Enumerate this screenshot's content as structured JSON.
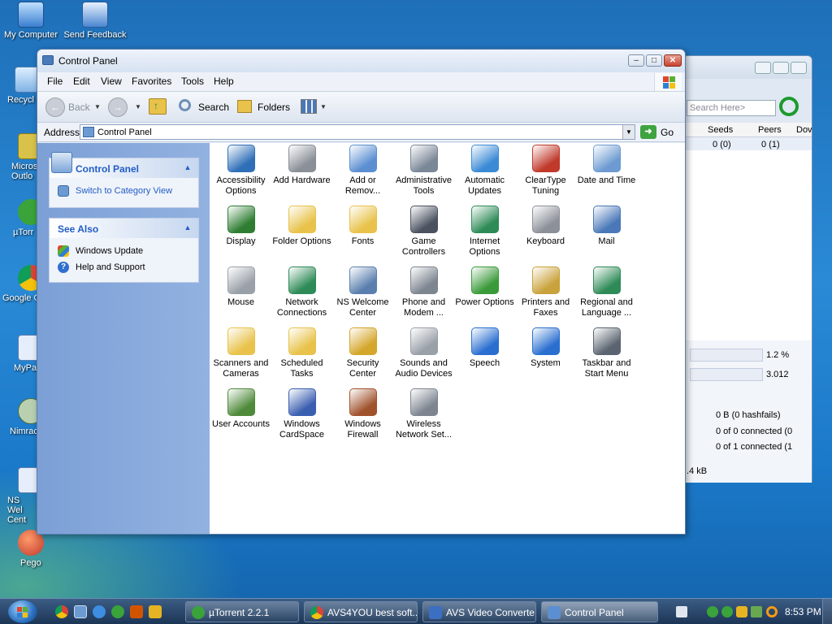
{
  "desktop": {
    "icons": [
      {
        "label": "My Computer"
      },
      {
        "label": "Send Feedback"
      },
      {
        "label": "Recycl"
      },
      {
        "label": "Micros Outlo"
      },
      {
        "label": "µTorr"
      },
      {
        "label": "Google C"
      },
      {
        "label": "MyPa"
      },
      {
        "label": "Nimrac"
      },
      {
        "label": "NS Wel Cent"
      },
      {
        "label": "Pego"
      }
    ]
  },
  "background_window": {
    "search_placeholder": "Search Here>",
    "columns": {
      "seeds": "Seeds",
      "peers": "Peers",
      "down": "Dov"
    },
    "row": {
      "seeds": "0 (0)",
      "peers": "0 (1)"
    },
    "stats": {
      "pct": "1.2 %",
      "ratio": "3.012"
    },
    "info": [
      "0 B (0 hashfails)",
      "0 of 0 connected (0",
      "0 of 1 connected (1"
    ],
    "status": ".4 kB"
  },
  "window": {
    "title": "Control Panel",
    "menu": [
      "File",
      "Edit",
      "View",
      "Favorites",
      "Tools",
      "Help"
    ],
    "toolbar": {
      "back": "Back",
      "search": "Search",
      "folders": "Folders"
    },
    "address": {
      "label": "Address",
      "value": "Control Panel",
      "go": "Go"
    }
  },
  "leftpane": {
    "control_panel": {
      "title": "Control Panel",
      "link": "Switch to Category View"
    },
    "see_also": {
      "title": "See Also",
      "links": [
        "Windows Update",
        "Help and Support"
      ]
    }
  },
  "items": [
    {
      "line1": "Accessibility",
      "line2": "Options",
      "icon": "accessibility-icon",
      "color": "#2f6fb8"
    },
    {
      "line1": "Add Hardware",
      "line2": "",
      "icon": "add-hardware-icon",
      "color": "#8a8f98"
    },
    {
      "line1": "Add or",
      "line2": "Remov...",
      "icon": "add-remove-programs-icon",
      "color": "#5b8fd1"
    },
    {
      "line1": "Administrative",
      "line2": "Tools",
      "icon": "administrative-tools-icon",
      "color": "#7a8797"
    },
    {
      "line1": "Automatic",
      "line2": "Updates",
      "icon": "automatic-updates-icon",
      "color": "#3a8ad6"
    },
    {
      "line1": "ClearType",
      "line2": "Tuning",
      "icon": "cleartype-icon",
      "color": "#c0392b"
    },
    {
      "line1": "Date and Time",
      "line2": "",
      "icon": "date-time-icon",
      "color": "#6d9bd1"
    },
    {
      "line1": "Display",
      "line2": "",
      "icon": "display-icon",
      "color": "#2e7d32"
    },
    {
      "line1": "Folder Options",
      "line2": "",
      "icon": "folder-options-icon",
      "color": "#e8c24a"
    },
    {
      "line1": "Fonts",
      "line2": "",
      "icon": "fonts-icon",
      "color": "#e8c24a"
    },
    {
      "line1": "Game",
      "line2": "Controllers",
      "icon": "game-controllers-icon",
      "color": "#4a5260"
    },
    {
      "line1": "Internet",
      "line2": "Options",
      "icon": "internet-options-icon",
      "color": "#2e8b57"
    },
    {
      "line1": "Keyboard",
      "line2": "",
      "icon": "keyboard-icon",
      "color": "#8c9099"
    },
    {
      "line1": "Mail",
      "line2": "",
      "icon": "mail-icon",
      "color": "#4a78b8"
    },
    {
      "line1": "Mouse",
      "line2": "",
      "icon": "mouse-icon",
      "color": "#9aa0a8"
    },
    {
      "line1": "Network",
      "line2": "Connections",
      "icon": "network-connections-icon",
      "color": "#2e8b57"
    },
    {
      "line1": "NS Welcome",
      "line2": "Center",
      "icon": "ns-welcome-center-icon",
      "color": "#5a7fae"
    },
    {
      "line1": "Phone and",
      "line2": "Modem ...",
      "icon": "phone-modem-icon",
      "color": "#7d8590"
    },
    {
      "line1": "Power Options",
      "line2": "",
      "icon": "power-options-icon",
      "color": "#3a9a3a"
    },
    {
      "line1": "Printers and",
      "line2": "Faxes",
      "icon": "printers-faxes-icon",
      "color": "#c9a23b"
    },
    {
      "line1": "Regional and",
      "line2": "Language ...",
      "icon": "regional-language-icon",
      "color": "#2e8b57"
    },
    {
      "line1": "Scanners and",
      "line2": "Cameras",
      "icon": "scanners-cameras-icon",
      "color": "#e8c24a"
    },
    {
      "line1": "Scheduled",
      "line2": "Tasks",
      "icon": "scheduled-tasks-icon",
      "color": "#e8c24a"
    },
    {
      "line1": "Security",
      "line2": "Center",
      "icon": "security-center-icon",
      "color": "#d4a62a"
    },
    {
      "line1": "Sounds and",
      "line2": "Audio Devices",
      "icon": "sounds-audio-icon",
      "color": "#9aa0a8"
    },
    {
      "line1": "Speech",
      "line2": "",
      "icon": "speech-icon",
      "color": "#2a6fd0"
    },
    {
      "line1": "System",
      "line2": "",
      "icon": "system-icon",
      "color": "#2a6fd0"
    },
    {
      "line1": "Taskbar and",
      "line2": "Start Menu",
      "icon": "taskbar-start-menu-icon",
      "color": "#5a6470"
    },
    {
      "line1": "User Accounts",
      "line2": "",
      "icon": "user-accounts-icon",
      "color": "#4f8a3a"
    },
    {
      "line1": "Windows",
      "line2": "CardSpace",
      "icon": "windows-cardspace-icon",
      "color": "#3b5fb0"
    },
    {
      "line1": "Windows",
      "line2": "Firewall",
      "icon": "windows-firewall-icon",
      "color": "#a0522d"
    },
    {
      "line1": "Wireless",
      "line2": "Network Set...",
      "icon": "wireless-network-icon",
      "color": "#7d8590"
    }
  ],
  "taskbar": {
    "tasks": [
      {
        "label": "µTorrent 2.2.1",
        "color": "#3aa33a"
      },
      {
        "label": "AVS4YOU best soft...",
        "color": "#dd5533"
      },
      {
        "label": "AVS Video Converte...",
        "color": "#3b6fc2"
      },
      {
        "label": "Control Panel",
        "color": "#5b8fd1"
      }
    ],
    "clock": "8:53 PM"
  }
}
